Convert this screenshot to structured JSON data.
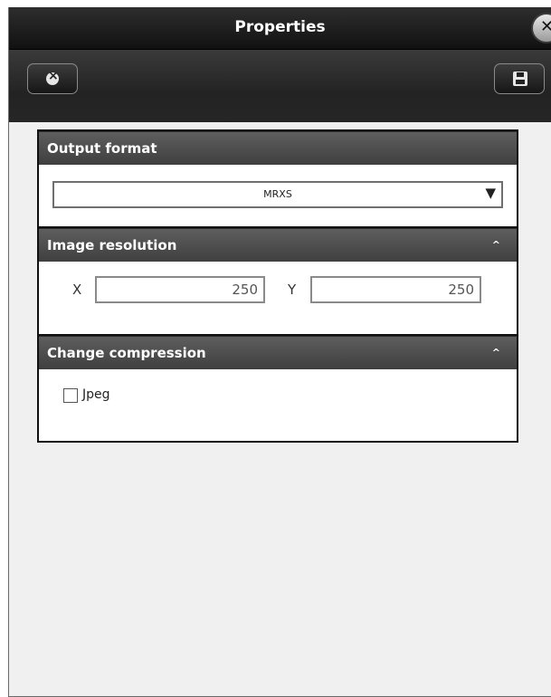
{
  "window": {
    "title": "Properties",
    "close_glyph": "✕"
  },
  "toolbar": {
    "left_button_icon": "reset-icon",
    "right_button_icon": "save-icon"
  },
  "output_format": {
    "header": "Output format",
    "selected": "MRXS",
    "arrow_glyph": "▼"
  },
  "image_resolution": {
    "header": "Image resolution",
    "chevron_glyph": "^",
    "x_label": "X",
    "x_value": "250",
    "y_label": "Y",
    "y_value": "250"
  },
  "compression": {
    "header": "Change compression",
    "chevron_glyph": "^",
    "checkbox_label": "Jpeg",
    "checked": false
  },
  "colors": {
    "title_bar": "#1a1a1a",
    "section_header": "#4e4e4e",
    "background": "#f0f0f0"
  }
}
